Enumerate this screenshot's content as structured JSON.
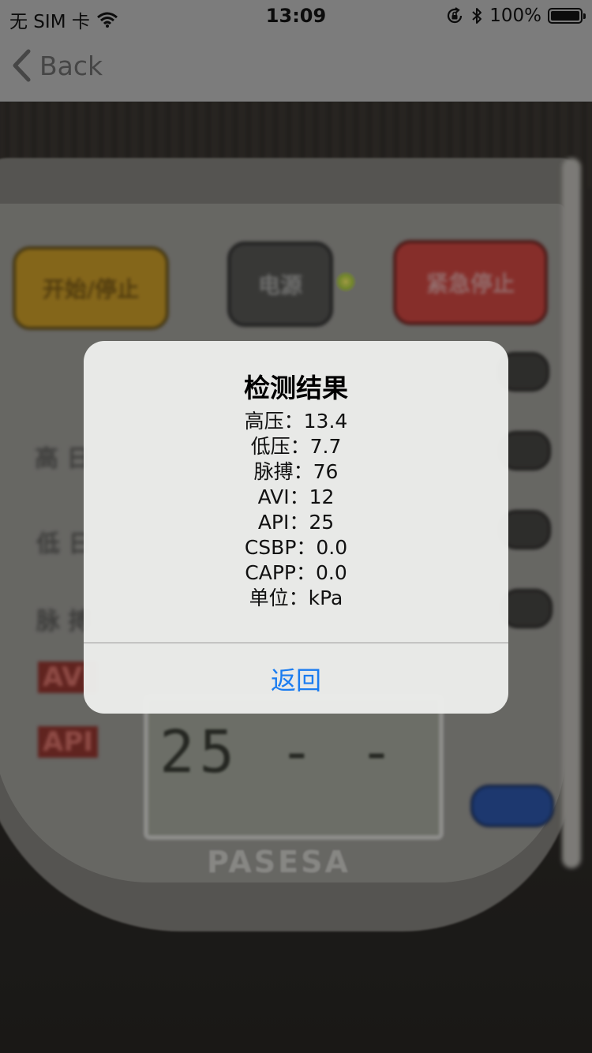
{
  "status_bar": {
    "carrier": "无 SIM 卡",
    "time": "13:09",
    "battery_percent": "100%",
    "battery_level": 1.0
  },
  "nav": {
    "back_label": "Back"
  },
  "background": {
    "button_start": "开始/停止",
    "button_power": "电源",
    "button_emergency": "紧急停止",
    "lcd_digits": "25 - -",
    "label_avi": "AVI",
    "label_api": "API",
    "brand": "PASESA"
  },
  "alert": {
    "title": "检测结果",
    "lines": [
      "高压：13.4",
      "低压：7.7",
      "脉搏：76",
      "AVI：12",
      "API：25",
      "CSBP：0.0",
      "CAPP：0.0",
      "单位：kPa"
    ],
    "button_label": "返回"
  },
  "colors": {
    "accent": "#1a7cf0",
    "alert_background": "#ecedeb",
    "bar_background": "#7c7c7c"
  }
}
